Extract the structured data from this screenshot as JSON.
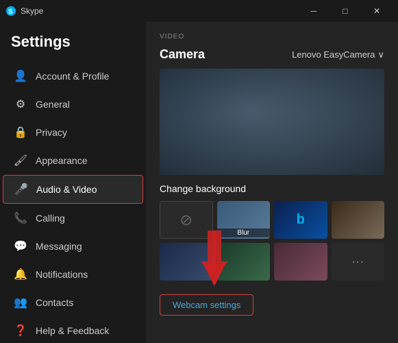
{
  "titlebar": {
    "icon": "S",
    "title": "Skype",
    "minimize": "─",
    "maximize": "□",
    "close": "✕"
  },
  "sidebar": {
    "title": "Settings",
    "items": [
      {
        "id": "account",
        "label": "Account & Profile",
        "icon": "👤"
      },
      {
        "id": "general",
        "label": "General",
        "icon": "⚙"
      },
      {
        "id": "privacy",
        "label": "Privacy",
        "icon": "🔒"
      },
      {
        "id": "appearance",
        "label": "Appearance",
        "icon": "🖌"
      },
      {
        "id": "audio-video",
        "label": "Audio & Video",
        "icon": "🎤",
        "active": true
      },
      {
        "id": "calling",
        "label": "Calling",
        "icon": "📞"
      },
      {
        "id": "messaging",
        "label": "Messaging",
        "icon": "💬"
      },
      {
        "id": "notifications",
        "label": "Notifications",
        "icon": "🔔"
      },
      {
        "id": "contacts",
        "label": "Contacts",
        "icon": "👥"
      },
      {
        "id": "help",
        "label": "Help & Feedback",
        "icon": "❓"
      }
    ]
  },
  "main": {
    "section_label": "VIDEO",
    "camera_label": "Camera",
    "camera_value": "Lenovo EasyCamera",
    "camera_chevron": "∨",
    "bg_label": "Change background",
    "bg_items": [
      {
        "id": "none",
        "type": "none",
        "label": ""
      },
      {
        "id": "blur",
        "type": "blur",
        "label": "Blur"
      },
      {
        "id": "b-logo",
        "type": "b-logo",
        "label": ""
      },
      {
        "id": "room1",
        "type": "room1",
        "label": ""
      },
      {
        "id": "dots",
        "type": "dots",
        "label": ""
      },
      {
        "id": "room2",
        "type": "room2",
        "label": ""
      },
      {
        "id": "room3",
        "type": "room3",
        "label": ""
      },
      {
        "id": "more",
        "type": "more",
        "label": "..."
      }
    ],
    "webcam_btn": "Webcam settings"
  }
}
